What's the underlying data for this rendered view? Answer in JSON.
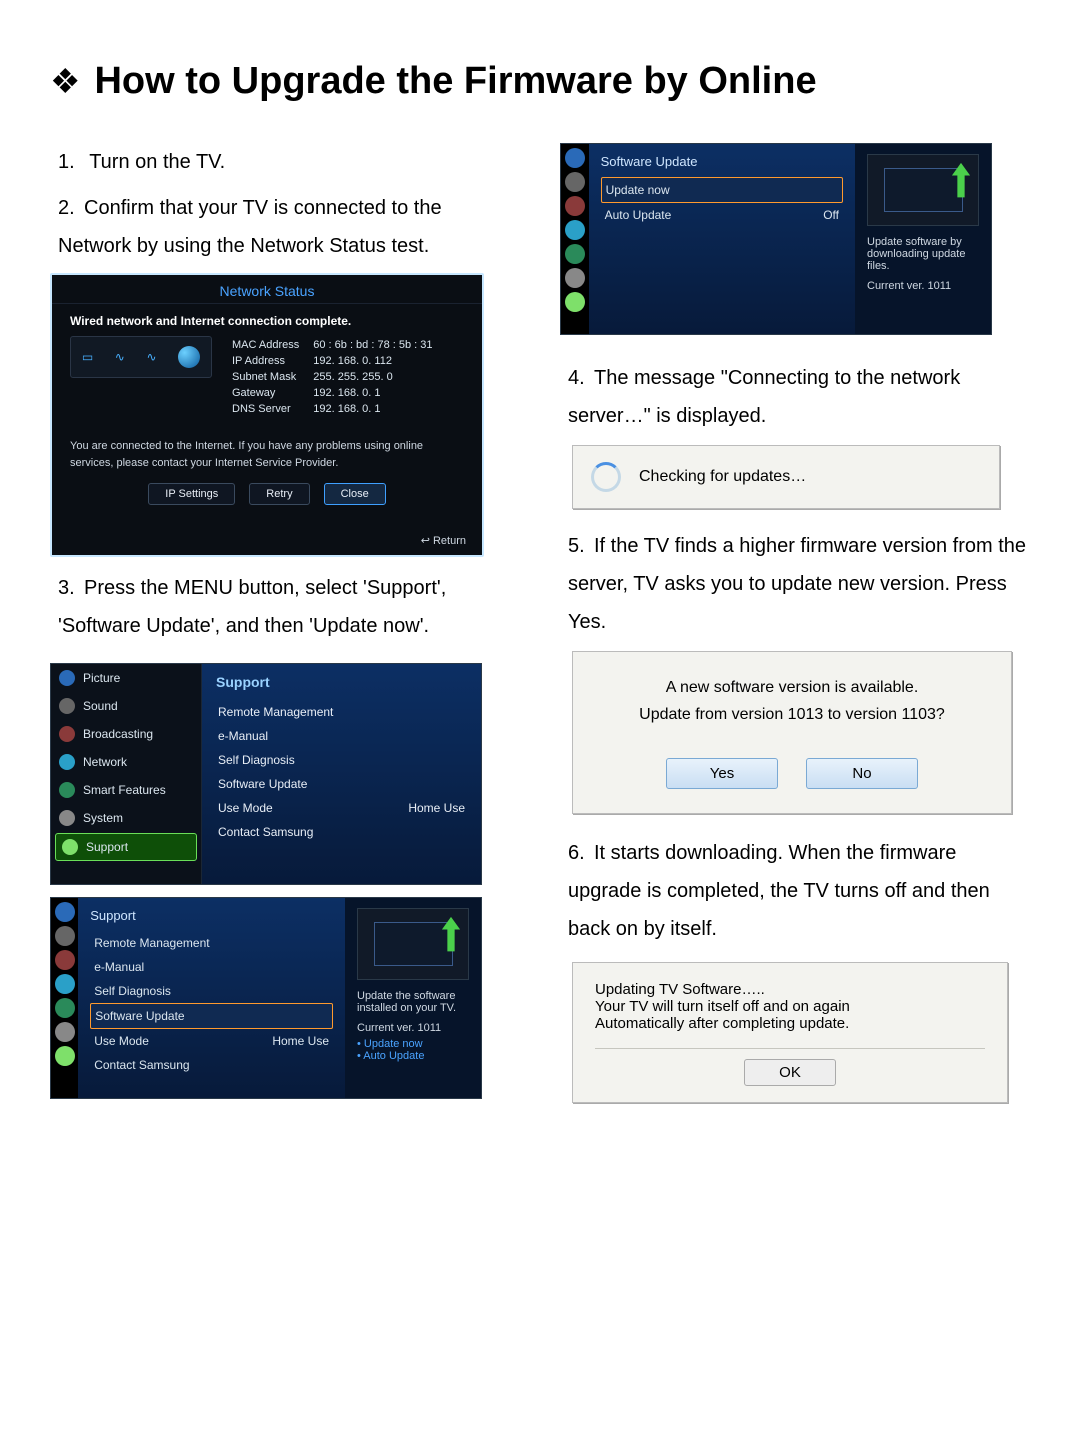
{
  "title_bullet": "❖",
  "title": "How to Upgrade the Firmware by Online",
  "steps": {
    "s1": "Turn on the TV.",
    "s2": "Confirm that your TV is connected to the Network by using the Network Status test.",
    "s3": "Press the MENU button, select 'Support', 'Software Update', and then 'Update now'.",
    "s4": "The message \"Connecting to the network server…\" is displayed.",
    "s5": "If the TV finds a higher firmware version from the server, TV asks you to update new version. Press Yes.",
    "s6": "It starts downloading. When the firmware upgrade is completed, the TV turns off and then back on by itself."
  },
  "network_status": {
    "title": "Network Status",
    "msg": "Wired network and Internet connection complete.",
    "fields": {
      "mac_label": "MAC Address",
      "mac": "60 : 6b : bd : 78 : 5b : 31",
      "ip_label": "IP Address",
      "ip": "192.  168.    0.  112",
      "sm_label": "Subnet Mask",
      "sm": "255.  255.  255.    0",
      "gw_label": "Gateway",
      "gw": "192.  168.    0.    1",
      "dns_label": "DNS Server",
      "dns": "192.  168.    0.    1"
    },
    "note": "You are connected to the Internet. If you have any problems using online services, please contact your Internet Service Provider.",
    "btn_ip": "IP Settings",
    "btn_retry": "Retry",
    "btn_close": "Close",
    "return": "↩ Return"
  },
  "support_menu": {
    "header": "Support",
    "left_items": [
      "Picture",
      "Sound",
      "Broadcasting",
      "Network",
      "Smart Features",
      "System",
      "Support"
    ],
    "right_items": [
      "Remote Management",
      "e-Manual",
      "Self Diagnosis",
      "Software Update",
      "Use Mode",
      "Contact Samsung"
    ],
    "use_mode_value": "Home Use"
  },
  "support_sub": {
    "header": "Support",
    "items": [
      "Remote Management",
      "e-Manual",
      "Self Diagnosis",
      "Software Update",
      "Use Mode",
      "Contact Samsung"
    ],
    "use_mode_value": "Home Use",
    "info1": "Update the software installed on your TV.",
    "info2": "Current ver. 1011",
    "info3a": "• Update now",
    "info3b": "• Auto Update"
  },
  "software_update": {
    "header": "Software Update",
    "items": [
      {
        "label": "Update now",
        "value": ""
      },
      {
        "label": "Auto Update",
        "value": "Off"
      }
    ],
    "info1": "Update software by downloading update files.",
    "info2": "Current ver. 1011"
  },
  "checking": {
    "text": "Checking for updates…"
  },
  "update_dialog": {
    "line1": "A new software version is available.",
    "line2": "Update from version 1013 to version 1103?",
    "yes": "Yes",
    "no": "No"
  },
  "updating_box": {
    "line1": "Updating TV Software…..",
    "line2": "Your TV will turn itself off and on again",
    "line3": "Automatically after completing update.",
    "ok": "OK"
  }
}
